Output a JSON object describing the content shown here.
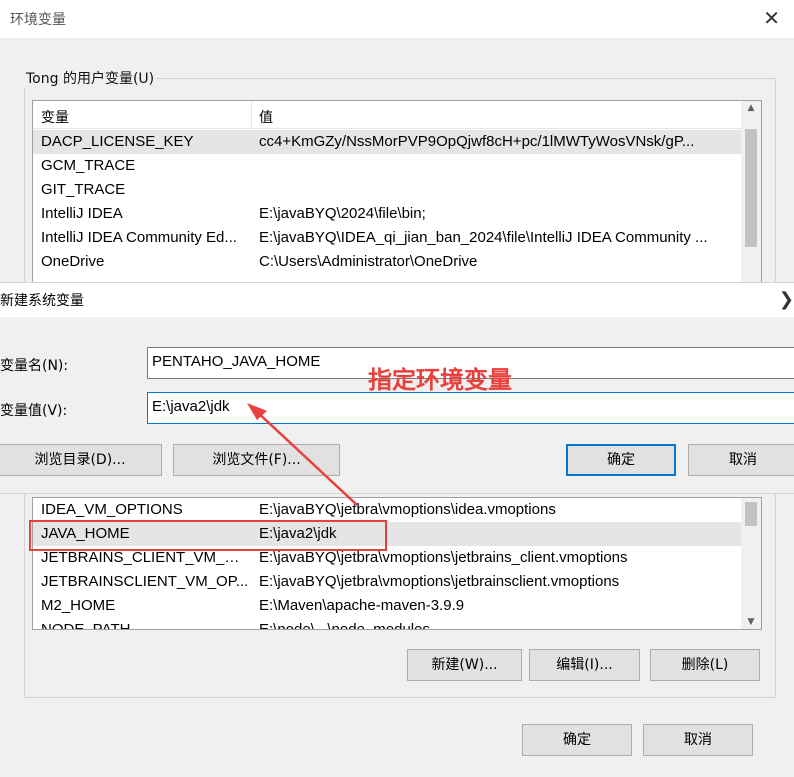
{
  "main_window": {
    "title": "环境变量",
    "user_group_label": "Tong 的用户变量(U)",
    "columns": {
      "variable": "变量",
      "value": "值"
    },
    "user_vars_top": [
      {
        "name": "DACP_LICENSE_KEY",
        "value": "cc4+KmGZy/NssMorPVP9OpQjwf8cH+pc/1lMWTyWosVNsk/gP..."
      },
      {
        "name": "GCM_TRACE",
        "value": ""
      },
      {
        "name": "GIT_TRACE",
        "value": ""
      },
      {
        "name": "IntelliJ IDEA",
        "value": "E:\\javaBYQ\\2024\\file\\bin;"
      },
      {
        "name": "IntelliJ IDEA Community Ed...",
        "value": "E:\\javaBYQ\\IDEA_qi_jian_ban_2024\\file\\IntelliJ IDEA Community ..."
      },
      {
        "name": "OneDrive",
        "value": "C:\\Users\\Administrator\\OneDrive"
      }
    ],
    "user_vars_bottom": [
      {
        "name": "IDEA_VM_OPTIONS",
        "value": "E:\\javaBYQ\\jetbra\\vmoptions\\idea.vmoptions"
      },
      {
        "name": "JAVA_HOME",
        "value": "E:\\java2\\jdk"
      },
      {
        "name": "JETBRAINS_CLIENT_VM_OP...",
        "value": "E:\\javaBYQ\\jetbra\\vmoptions\\jetbrains_client.vmoptions"
      },
      {
        "name": "JETBRAINSCLIENT_VM_OP...",
        "value": "E:\\javaBYQ\\jetbra\\vmoptions\\jetbrainsclient.vmoptions"
      },
      {
        "name": "M2_HOME",
        "value": "E:\\Maven\\apache-maven-3.9.9"
      },
      {
        "name": "NODE_PATH",
        "value": "E:\\node\\...\\node_modules"
      }
    ],
    "buttons": {
      "new": "新建(W)...",
      "edit": "编辑(I)...",
      "delete": "删除(L)",
      "ok": "确定",
      "cancel": "取消"
    }
  },
  "new_var_dialog": {
    "title": "新建系统变量",
    "name_label": "变量名(N):",
    "value_label": "变量值(V):",
    "name_value": "PENTAHO_JAVA_HOME",
    "value_value": "E:\\java2\\jdk",
    "buttons": {
      "browse_dir": "浏览目录(D)...",
      "browse_file": "浏览文件(F)...",
      "ok": "确定",
      "cancel": "取消"
    }
  },
  "annotation": {
    "text": "指定环境变量",
    "color": "#e8403c"
  },
  "colors": {
    "accent": "#0078d7",
    "highlight_red": "#e8403c"
  }
}
